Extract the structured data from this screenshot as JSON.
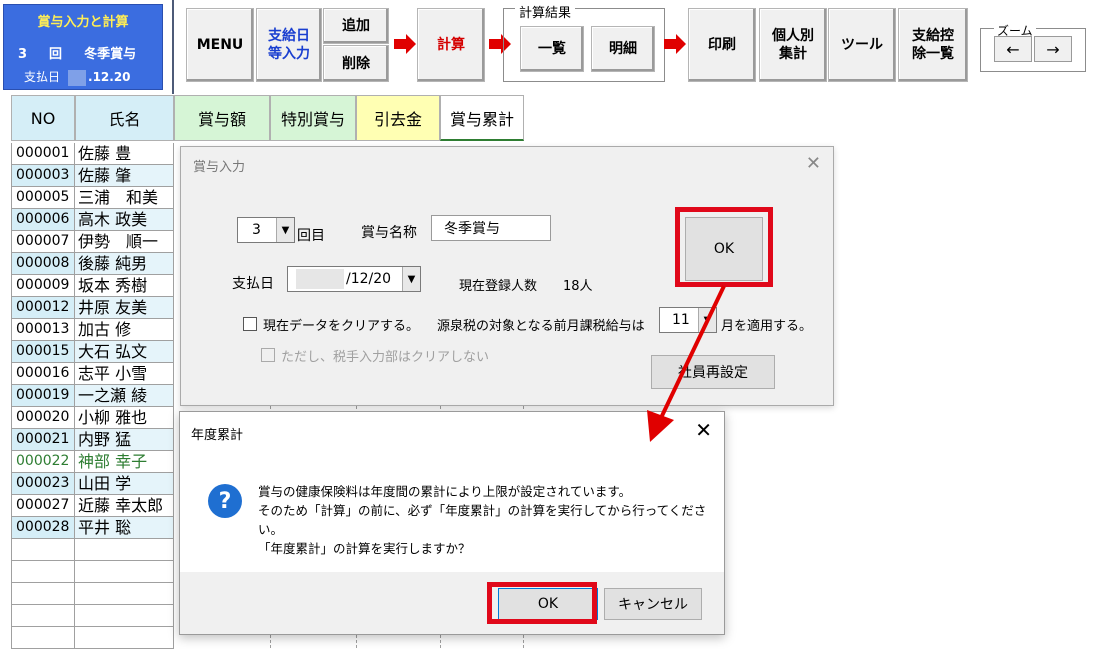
{
  "title_panel": {
    "title": "賞与入力と計算",
    "round_number": "3",
    "round_unit": "回",
    "bonus_name": "冬季賞与",
    "pay_date_label": "支払日",
    "pay_date_value": ".12.20"
  },
  "toolbar": {
    "menu": "MENU",
    "pay_date_entry": "支給日等入力",
    "add": "追加",
    "delete": "削除",
    "calculate": "計算",
    "calc_result_label": "計算結果",
    "list": "一覧",
    "detail": "明細",
    "print": "印刷",
    "per_person_total": "個人別集計",
    "tools": "ツール",
    "deduction_list": "支給控除一覧",
    "zoom_label": "ズーム",
    "zoom_left": "←",
    "zoom_right": "→"
  },
  "grid": {
    "headers": {
      "no": "NO",
      "name": "氏名",
      "bonus": "賞与額",
      "special_bonus": "特別賞与",
      "deduction": "引去金",
      "cumulative": "賞与累計"
    },
    "rows": [
      {
        "no": "000001",
        "name": "佐藤 豊"
      },
      {
        "no": "000003",
        "name": "佐藤 肇"
      },
      {
        "no": "000005",
        "name": "三浦　和美"
      },
      {
        "no": "000006",
        "name": "高木 政美"
      },
      {
        "no": "000007",
        "name": "伊勢　順一"
      },
      {
        "no": "000008",
        "name": "後藤 純男"
      },
      {
        "no": "000009",
        "name": "坂本 秀樹"
      },
      {
        "no": "000012",
        "name": "井原 友美"
      },
      {
        "no": "000013",
        "name": "加古 修"
      },
      {
        "no": "000015",
        "name": "大石 弘文"
      },
      {
        "no": "000016",
        "name": "志平 小雪"
      },
      {
        "no": "000019",
        "name": "一之瀬 綾"
      },
      {
        "no": "000020",
        "name": "小柳 雅也"
      },
      {
        "no": "000021",
        "name": "内野 猛"
      },
      {
        "no": "000022",
        "name": "神部 幸子"
      },
      {
        "no": "000023",
        "name": "山田 学"
      },
      {
        "no": "000027",
        "name": "近藤 幸太郎"
      },
      {
        "no": "000028",
        "name": "平井 聡"
      }
    ]
  },
  "bonus_dialog": {
    "title": "賞与入力",
    "round_value": "3",
    "round_suffix": "回目",
    "bonus_name_label": "賞与名称",
    "bonus_name_value": "冬季賞与",
    "pay_date_label": "支払日",
    "pay_date_value": "/12/20",
    "registered_label": "現在登録人数",
    "registered_count": "18人",
    "clear_data_label": "現在データをクリアする。",
    "keep_manual_label": "ただし、税手入力部はクリアしない",
    "withholding_label": "源泉税の対象となる前月課税給与は",
    "withholding_month": "11",
    "withholding_suffix": "月を適用する。",
    "ok": "OK",
    "reset_staff": "社員再設定"
  },
  "cumulative_dialog": {
    "title": "年度累計",
    "message_line1": "賞与の健康保険料は年度間の累計により上限が設定されています。",
    "message_line2": "そのため「計算」の前に、必ず「年度累計」の計算を実行してから行ってください。",
    "message_line3": "「年度累計」の計算を実行しますか？",
    "ok": "OK",
    "cancel": "キャンセル"
  },
  "colors": {
    "title_panel_bg": "#3b6de0",
    "highlight": "#e0081a",
    "arrow": "#e00000"
  }
}
